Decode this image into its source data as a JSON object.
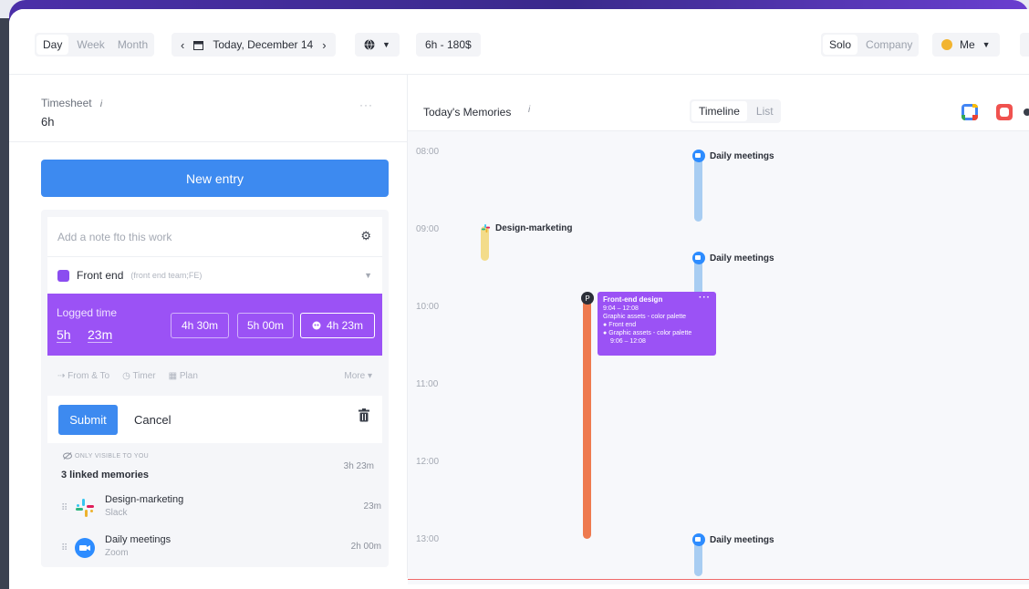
{
  "toolbar": {
    "view_tabs": [
      "Day",
      "Week",
      "Month"
    ],
    "date_label": "Today, December 14",
    "summary": "6h - 180$",
    "scope_tabs": [
      "Solo",
      "Company"
    ],
    "user_label": "Me"
  },
  "timesheet": {
    "title": "Timesheet",
    "hours": "6h",
    "more": "···",
    "new_entry_label": "New entry"
  },
  "entry_form": {
    "note_placeholder": "Add a note fto this work",
    "project_name": "Front end",
    "project_team": "(front end team;FE)",
    "logged_time_label": "Logged time",
    "logged_hours": "5h",
    "logged_minutes": "23m",
    "presets": [
      "4h 30m",
      "5h 00m",
      "4h 23m"
    ],
    "options": [
      "From & To",
      "Timer",
      "Plan"
    ],
    "more_label": "More",
    "submit_label": "Submit",
    "cancel_label": "Cancel"
  },
  "linked": {
    "visibility_note": "ONLY VISIBLE TO YOU",
    "title": "3 linked memories",
    "total": "3h 23m",
    "items": [
      {
        "name": "Design-marketing",
        "source": "Slack",
        "duration": "23m"
      },
      {
        "name": "Daily meetings",
        "source": "Zoom",
        "duration": "2h 00m"
      }
    ]
  },
  "memories": {
    "title": "Today's Memories",
    "info": "i",
    "view_tabs": [
      "Timeline",
      "List"
    ],
    "hours": [
      "08:00",
      "09:00",
      "10:00",
      "11:00",
      "12:00",
      "13:00"
    ],
    "events": [
      {
        "label": "Daily meetings"
      },
      {
        "label": "Design-marketing"
      },
      {
        "label": "Daily meetings"
      },
      {
        "label": "Daily meetings"
      }
    ],
    "card": {
      "title": "Front-end design",
      "time": "9:04 – 12:08",
      "line1": "Graphic assets - color palette",
      "line2": "Front end",
      "line3": "Graphic assets - color palette",
      "line4": "9:06 – 12:08",
      "avatar": "P"
    }
  },
  "colors": {
    "accent_blue": "#3d8af0",
    "purple": "#9b52f5",
    "zoom_blue": "#2d8cff",
    "orange": "#ee7a4f"
  }
}
